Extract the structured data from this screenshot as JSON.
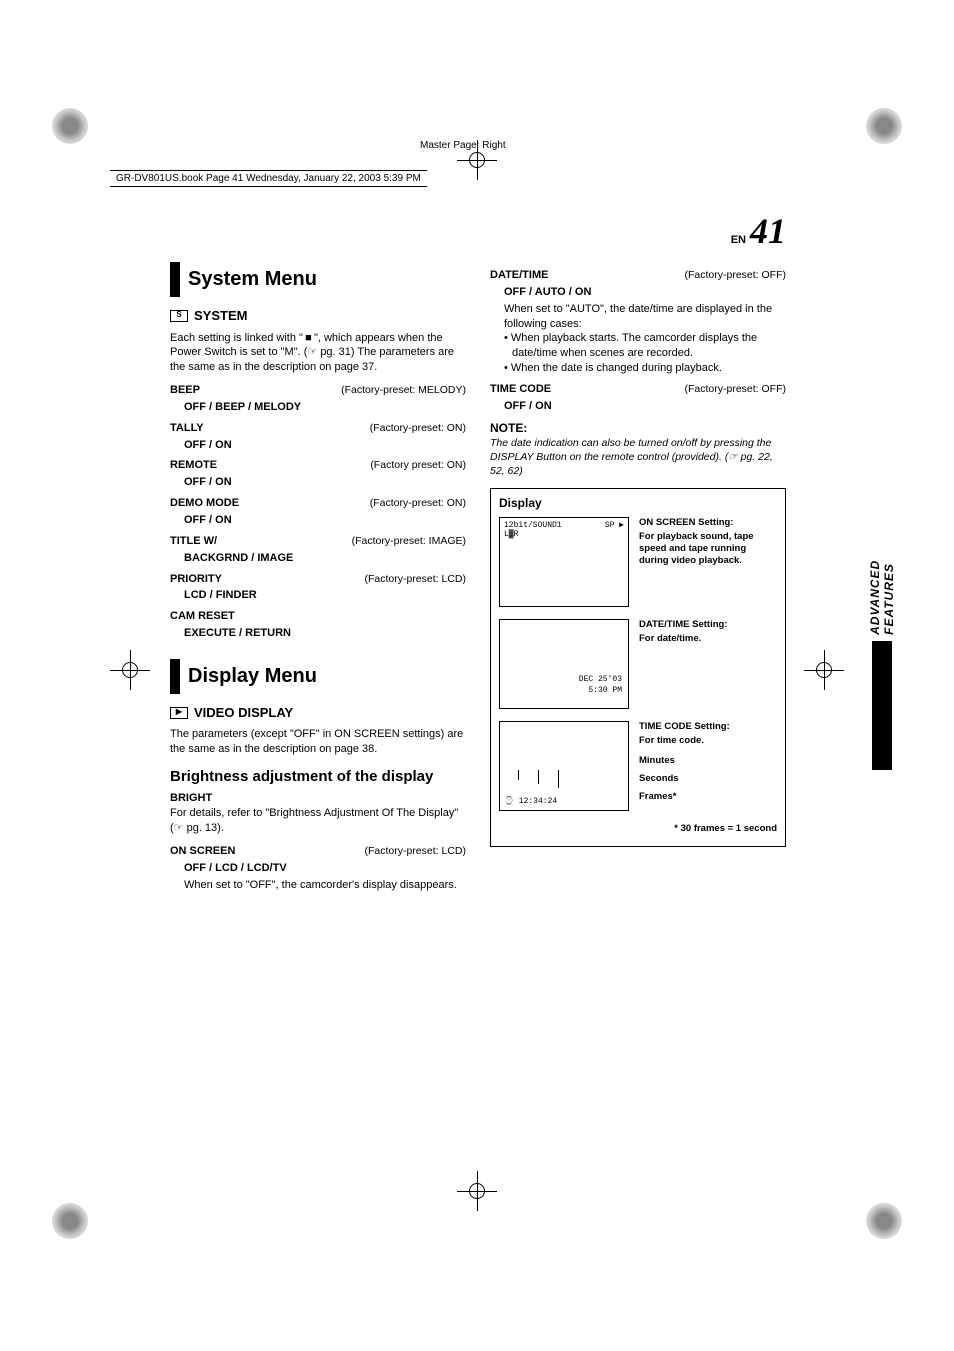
{
  "meta": {
    "master_page": "Master Page: Right",
    "bookline": "GR-DV801US.book  Page 41  Wednesday, January 22, 2003  5:39 PM",
    "en": "EN",
    "page_num": "41",
    "side_tab": "ADVANCED FEATURES"
  },
  "left": {
    "section1_title": "System Menu",
    "system_subhead": "SYSTEM",
    "system_intro": "Each setting is linked with \" ■ \", which appears when the Power Switch is set to \"M\". (☞ pg. 31) The parameters are the same as in the description on page 37.",
    "items": [
      {
        "k": "BEEP",
        "v": "(Factory-preset: MELODY)",
        "sub": "OFF / BEEP / MELODY"
      },
      {
        "k": "TALLY",
        "v": "(Factory-preset: ON)",
        "sub": "OFF / ON"
      },
      {
        "k": "REMOTE",
        "v": "(Factory preset: ON)",
        "sub": "OFF / ON"
      },
      {
        "k": "DEMO MODE",
        "v": "(Factory-preset: ON)",
        "sub": "OFF / ON"
      },
      {
        "k": "TITLE W/",
        "v": "(Factory-preset: IMAGE)",
        "sub": "BACKGRND / IMAGE"
      },
      {
        "k": "PRIORITY",
        "v": "(Factory-preset: LCD)",
        "sub": "LCD / FINDER"
      },
      {
        "k": "CAM RESET",
        "v": "",
        "sub": "EXECUTE / RETURN"
      }
    ],
    "section2_title": "Display Menu",
    "video_subhead": "VIDEO DISPLAY",
    "video_intro": "The parameters (except \"OFF\" in ON SCREEN settings) are the same as in the description on page 38.",
    "bright_head": "Brightness adjustment of the display",
    "bright_k": "BRIGHT",
    "bright_body": "For details, refer to \"Brightness Adjustment Of The Display\" (☞ pg. 13).",
    "onscreen": {
      "k": "ON SCREEN",
      "v": "(Factory-preset: LCD)",
      "sub": "OFF / LCD / LCD/TV",
      "note": "When set to \"OFF\", the camcorder's display disappears."
    }
  },
  "right": {
    "datetime": {
      "k": "DATE/TIME",
      "v": "(Factory-preset: OFF)",
      "sub": "OFF / AUTO / ON",
      "body": "When set to \"AUTO\", the date/time are displayed in the following cases:",
      "bullets": [
        "When playback starts. The camcorder displays the date/time when scenes are recorded.",
        "When the date is changed during playback."
      ]
    },
    "timecode": {
      "k": "TIME CODE",
      "v": "(Factory-preset: OFF)",
      "sub": "OFF / ON"
    },
    "note_hd": "NOTE:",
    "note_body": "The date indication can also be turned on/off by pressing the DISPLAY Button on the remote control (provided). (☞ pg. 22, 52, 62)",
    "display": {
      "title": "Display",
      "panel1": {
        "tl": "12bit/SOUND1",
        "tr": "SP ▶",
        "l2": "L▓R"
      },
      "panel1_desc_head": "ON SCREEN Setting:",
      "panel1_desc": "For playback sound, tape speed and tape running during video playback.",
      "panel2": {
        "date1": "DEC 25'03",
        "date2": "5:30 PM"
      },
      "panel2_desc_head": "DATE/TIME Setting:",
      "panel2_desc": "For date/time.",
      "panel3": {
        "tc_icon": "⌚",
        "tc": "12:34:24"
      },
      "panel3_desc_head": "TIME CODE Setting:",
      "panel3_desc": "For time code.",
      "tc_labels": [
        "Minutes",
        "Seconds",
        "Frames*"
      ],
      "star": "* 30 frames = 1 second"
    }
  }
}
